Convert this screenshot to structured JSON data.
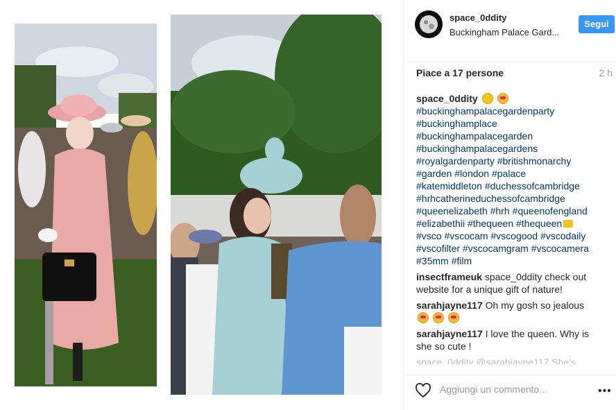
{
  "post": {
    "username": "space_0ddity",
    "location": "Buckingham Palace Gard...",
    "follow_label": "Segui",
    "likes": "Piace a 17 persone",
    "time": "2 h",
    "caption": {
      "user": "space_0ddity",
      "hashtag_lines": [
        "#buckinghampalacegardenparty",
        "#buckinghamplace",
        "#buckinghampalacegarden",
        "#buckinghampalacegardens",
        "#royalgardenparty #britishmonarchy",
        "#garden #london #palace",
        "#katemiddleton #duchessofcambridge",
        "#hrhcatherineduchessofcambridge",
        "#queenelizabeth #hrh #queenofengland",
        "#elizabethii #thequeen #thequeen",
        "#vsco #vscocam #vscogood #vscodaily",
        "#vscofilter #vscocamgram #vscocamera",
        "#35mm #film"
      ]
    },
    "comments": [
      {
        "user": "insectframeuk",
        "text": "space_0ddity check out website for a unique gift of nature!"
      },
      {
        "user": "sarahjayne117",
        "text": "Oh my gosh so jealous"
      },
      {
        "user": "sarahjayne117",
        "text": "I love the queen. Why is she so cute !"
      }
    ],
    "faded_comment": "space_0ddity @sarahjayne117 She's",
    "add_comment_placeholder": "Aggiungi un commento...",
    "more_label": "•••"
  },
  "icons": {
    "heart": "heart-icon",
    "more": "more-options-icon"
  },
  "colors": {
    "follow_button": "#3897f0",
    "hashtag": "#003569",
    "muted": "#999999"
  }
}
